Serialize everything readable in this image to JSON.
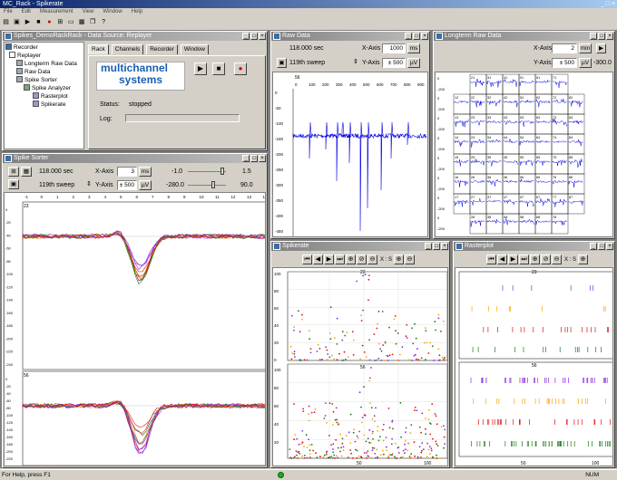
{
  "app": {
    "title": "MC_Rack - Spikerate",
    "menu": [
      "File",
      "Edit",
      "Measurement",
      "View",
      "Window",
      "Help"
    ],
    "status_text": "For Help, press F1",
    "status_right": "NUM"
  },
  "rack": {
    "title": "Spikes_DemoRackRack - Data Source: Replayer",
    "tree": [
      "Recorder",
      "Replayer",
      "Longterm Raw Data",
      "Raw Data",
      "Spike Sorter",
      "Spike Analyzer",
      "Rasterplot",
      "Spikerate"
    ],
    "tabs": [
      "Rack",
      "Channels",
      "Recorder",
      "Window"
    ],
    "logo_line1": "multichannel",
    "logo_line2": "systems",
    "status_label": "Status:",
    "status_value": "stopped",
    "log_label": "Log:"
  },
  "rawdata": {
    "title": "Raw Data",
    "time": "118.000 sec",
    "sweep": "119th sweep",
    "xaxis_label": "X-Axis",
    "xaxis_value": "1000",
    "xaxis_unit": "ms",
    "yaxis_label": "Y-Axis",
    "yaxis_value": "± 500",
    "yaxis_unit": "µV",
    "channel": "56",
    "xticks": [
      "0",
      "100",
      "200",
      "300",
      "400",
      "500",
      "600",
      "700",
      "800",
      "900"
    ],
    "yticks": [
      "0",
      "-50",
      "-100",
      "-150",
      "-200",
      "-250",
      "-300",
      "-350",
      "-400",
      "-450"
    ]
  },
  "longterm": {
    "title": "Longterm Raw Data",
    "xaxis_value": "2",
    "xaxis_unit": "min",
    "yaxis_value": "± 500",
    "yaxis_unit": "µV",
    "offset": "-300.0",
    "channels": [
      "21",
      "31",
      "41",
      "51",
      "61",
      "71",
      "12",
      "22",
      "32",
      "42",
      "52",
      "62",
      "72",
      "82",
      "13",
      "23",
      "33",
      "43",
      "53",
      "63",
      "73",
      "83",
      "14",
      "24",
      "34",
      "44",
      "54",
      "64",
      "74",
      "84",
      "15",
      "25",
      "35",
      "45",
      "55",
      "65",
      "75",
      "85",
      "16",
      "26",
      "36",
      "46",
      "56",
      "66",
      "76",
      "86",
      "17",
      "27",
      "37",
      "47",
      "57",
      "67",
      "77",
      "87",
      "28",
      "38",
      "48",
      "58",
      "68",
      "78"
    ]
  },
  "spikesorter": {
    "title": "Spike Sorter",
    "time": "118.000 sec",
    "sweep": "119th sweep",
    "xaxis_label": "X-Axis",
    "xaxis_value": "3",
    "xaxis_unit": "ms",
    "yaxis_label": "Y-Axis",
    "yaxis_value": "± 500",
    "yaxis_unit": "µV",
    "thr1_left": "-1.0",
    "thr1_right": "1.5",
    "thr2_left": "-280.0",
    "thr2_right": "90.0",
    "xticks": [
      "-1",
      "0",
      "1",
      "2",
      "3",
      "4",
      "5",
      "6",
      "7",
      "8",
      "9",
      "10",
      "11",
      "12",
      "13",
      "14"
    ],
    "channel_top": "23",
    "channel_bottom": "56",
    "yticks": [
      "0",
      "-20",
      "-40",
      "-60",
      "-80",
      "-100",
      "-120",
      "-140",
      "-160",
      "-180",
      "-200",
      "-220",
      "-240"
    ]
  },
  "spikerate": {
    "title": "Spikerate",
    "channel_top": "23",
    "channel_bottom": "56",
    "yticks_top": [
      "100",
      "80",
      "60",
      "40",
      "20",
      "0"
    ],
    "yticks_bottom": [
      "100",
      "80",
      "60",
      "40",
      "20"
    ],
    "xticks": [
      "50",
      "100"
    ],
    "xs_label": "X : S"
  },
  "rasterplot": {
    "title": "Rasterplot",
    "channel_top": "23",
    "channel_bottom": "56",
    "xticks": [
      "50",
      "100"
    ],
    "xs_label": "X : S"
  },
  "colors": {
    "trace_blue": "#0000e0",
    "purple": "#8a2be2",
    "red": "#e01010",
    "orange": "#ffa500",
    "green": "#1a7a1a"
  }
}
